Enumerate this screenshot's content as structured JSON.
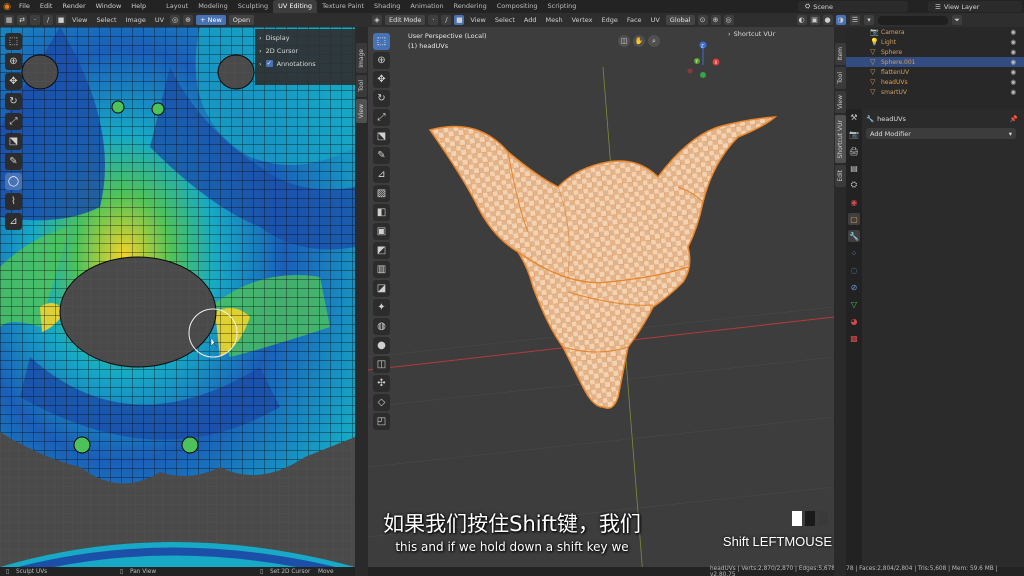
{
  "app": {
    "menu": [
      "File",
      "Edit",
      "Render",
      "Window",
      "Help"
    ],
    "workspace_tabs": [
      "Layout",
      "Modeling",
      "Sculpting",
      "UV Editing",
      "Texture Paint",
      "Shading",
      "Animation",
      "Rendering",
      "Compositing",
      "Scripting"
    ],
    "active_workspace": "UV Editing",
    "scene": "Scene",
    "view_layer": "View Layer"
  },
  "uv_editor": {
    "header": {
      "view": "View",
      "select": "Select",
      "image": "Image",
      "uv": "UV",
      "new": "+ New",
      "open": "Open"
    },
    "npanel": {
      "display": "Display",
      "cursor": "2D Cursor",
      "annotations": "Annotations"
    },
    "side_tabs": [
      "Image",
      "Tool",
      "View"
    ]
  },
  "viewport": {
    "header": {
      "mode": "Edit Mode",
      "view": "View",
      "select": "Select",
      "add": "Add",
      "mesh": "Mesh",
      "vertex": "Vertex",
      "edge": "Edge",
      "face": "Face",
      "uv": "UV",
      "orientation": "Global"
    },
    "info_line1": "User Perspective (Local)",
    "info_line2": "(1) headUVs",
    "shortcut_label": "Shortcut VUr",
    "side_tabs": [
      "Item",
      "Tool",
      "View",
      "Shortcut VUr",
      "Edit"
    ],
    "gizmo": {
      "x": "X",
      "y": "Y",
      "z": "Z"
    }
  },
  "outliner": {
    "items": [
      {
        "name": "Camera",
        "icon": "camera-icon",
        "glyph": "📷",
        "color": "#d0a060"
      },
      {
        "name": "Light",
        "icon": "light-icon",
        "glyph": "💡",
        "color": "#d0a060"
      },
      {
        "name": "Sphere",
        "icon": "mesh-icon",
        "glyph": "▽",
        "color": "#d0a060"
      },
      {
        "name": "Sphere.001",
        "icon": "mesh-icon",
        "glyph": "▽",
        "color": "#d0a060"
      },
      {
        "name": "flattenUV",
        "icon": "mesh-icon",
        "glyph": "▽",
        "color": "#d0a060"
      },
      {
        "name": "headUVs",
        "icon": "mesh-icon",
        "glyph": "▽",
        "color": "#e89b4a"
      },
      {
        "name": "smartUV",
        "icon": "mesh-icon",
        "glyph": "▽",
        "color": "#d0a060"
      }
    ],
    "selected_index": 3
  },
  "properties": {
    "object_name": "headUVs",
    "add_modifier": "Add Modifier"
  },
  "statusbar": {
    "sculpt": "Sculpt UVs",
    "pan": "Pan View",
    "cursor": "Set 2D Cursor",
    "move": "Move",
    "stats": "headUVs | Verts:2,870/2,870 | Edges:5,678/5,678 | Faces:2,804/2,804 | Tris:5,608 | Mem: 59.6 MB | v2.80.75"
  },
  "subtitles": {
    "chinese": "如果我们按住Shift键，我们",
    "english": "this and if we hold down a shift key we"
  },
  "key_overlay": "Shift LEFTMOUSE",
  "colors": {
    "accent": "#4772b3",
    "mesh_orange": "#e89b4a",
    "uv_blue": "#1b4fa8",
    "uv_cyan": "#17a9c6",
    "uv_green": "#4ec25a",
    "uv_yellow": "#f2d42b"
  }
}
